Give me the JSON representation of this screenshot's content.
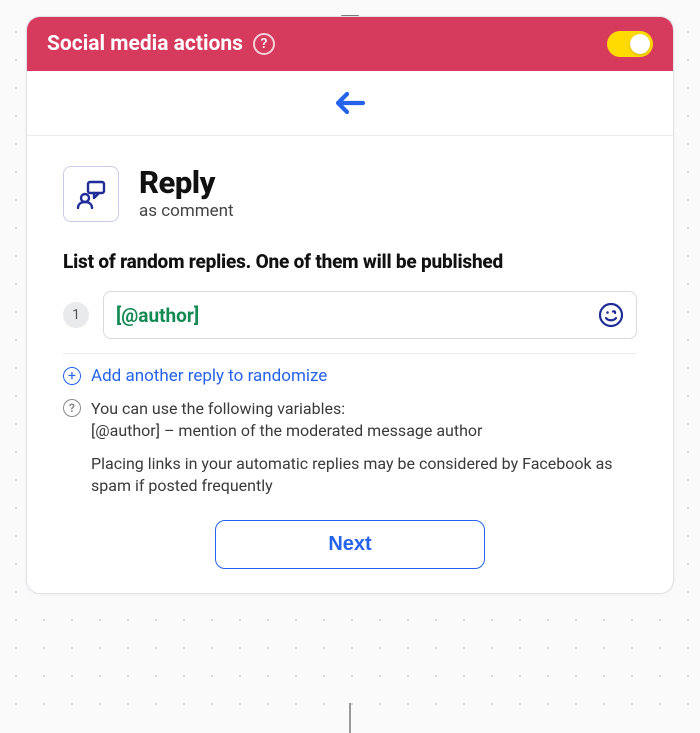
{
  "header": {
    "title": "Social media actions",
    "help_glyph": "?",
    "toggle_on": true
  },
  "back": {
    "label": "Back"
  },
  "reply": {
    "title": "Reply",
    "subtitle": "as comment"
  },
  "section_label": "List of random replies. One of them will be published",
  "replies": [
    {
      "index": "1",
      "value": "[@author]"
    }
  ],
  "add_label": "Add another reply to randomize",
  "hint": {
    "help_glyph": "?",
    "line1": "You can use the following variables:",
    "line2": "[@author] – mention of the moderated message author"
  },
  "warning": "Placing links in your automatic replies may be considered by Facebook as spam if posted frequently",
  "next_label": "Next"
}
